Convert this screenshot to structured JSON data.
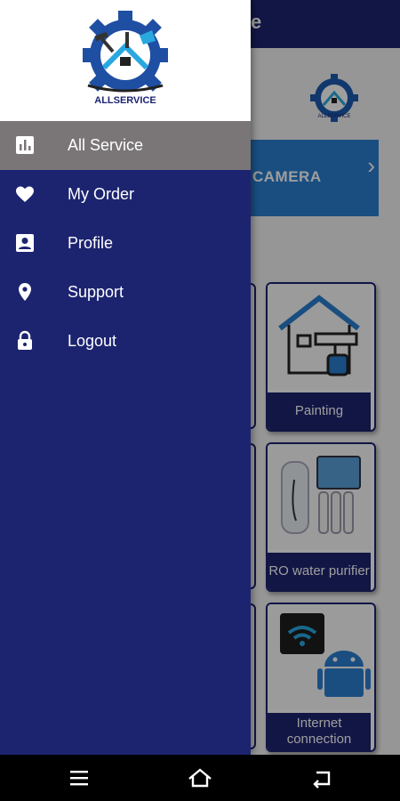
{
  "app": {
    "title_fragment": "e",
    "logo_text": "ALLSERVICE",
    "brand_color": "#1c2470"
  },
  "banner": {
    "label": "CAMERA",
    "chevron": "›"
  },
  "cards": [
    {
      "label": "Painting",
      "icon": "house-painting-icon"
    },
    {
      "label": "RO water purifier",
      "icon": "water-purifier-icon"
    },
    {
      "label": "Internet connection",
      "icon": "wifi-android-icon"
    }
  ],
  "drawer": {
    "logo_text": "ALLSERVICE",
    "items": [
      {
        "label": "All Service",
        "icon": "bar-chart-icon",
        "active": true
      },
      {
        "label": "My Order",
        "icon": "heart-icon",
        "active": false
      },
      {
        "label": "Profile",
        "icon": "account-box-icon",
        "active": false
      },
      {
        "label": "Support",
        "icon": "location-pin-icon",
        "active": false
      },
      {
        "label": "Logout",
        "icon": "lock-icon",
        "active": false
      }
    ]
  },
  "navbar": {
    "buttons": [
      "menu-icon",
      "home-icon",
      "back-icon"
    ]
  }
}
